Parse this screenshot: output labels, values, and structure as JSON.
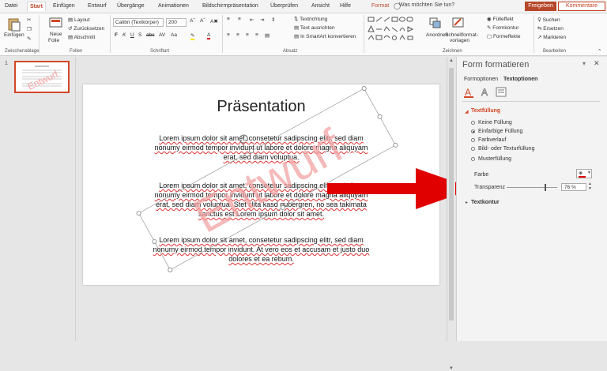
{
  "menu": {
    "tabs": [
      "Datei",
      "Start",
      "Einfügen",
      "Entwurf",
      "Übergänge",
      "Animationen",
      "Bildschirmpräsentation",
      "Überprüfen",
      "Ansicht",
      "Hilfe",
      "Format"
    ],
    "active_tab": "Start",
    "search_placeholder": "Was möchten Sie tun?",
    "share": "Freigeben",
    "comments": "Kommentare"
  },
  "ribbon": {
    "clipboard": {
      "paste": "Einfügen",
      "label": "Zwischenablage"
    },
    "slides": {
      "new": "Neue",
      "new2": "Folie",
      "layout": "Layout",
      "reset": "Zurücksetzen",
      "section": "Abschnitt",
      "label": "Folien"
    },
    "font": {
      "name": "Calibri (Textkörper)",
      "size": "200",
      "label": "Schriftart"
    },
    "paragraph": {
      "direction": "Textrichtung",
      "align": "Text ausrichten",
      "smartart": "In SmartArt konvertieren",
      "label": "Absatz"
    },
    "drawing": {
      "arrange": "Anordnen",
      "quickstyles": "Schnellformat-",
      "quickstyles2": "vorlagen",
      "fill": "Fülleffekt",
      "outline": "Formkontur",
      "effects": "Formeffekte",
      "label": "Zeichnen"
    },
    "editing": {
      "find": "Suchen",
      "replace": "Ersetzen",
      "select": "Markieren",
      "label": "Bearbeiten"
    }
  },
  "slide_panel": {
    "number": "1"
  },
  "slide": {
    "title": "Präsentation",
    "watermark": "Entwurf",
    "paragraphs": [
      [
        "Lorem ipsum dolor sit amet, consetetur sadipscing elitr, sed diam",
        "nonumy eirmod tempor invidunt ut labore et dolore magna aliquyam",
        "erat, sed diam voluptua."
      ],
      [
        "Lorem ipsum dolor sit amet, consetetur sadipscing elitr, sed diam",
        "nonumy eirmod tempor invidunt ut labore et dolore magna aliquyam",
        "erat, sed diam voluptua. Stet clita kasd gubergren, no sea takimata",
        "sanctus est Lorem ipsum dolor sit amet."
      ],
      [
        "Lorem ipsum dolor sit amet, consetetur sadipscing elitr, sed diam",
        "nonumy eirmod tempor invidunt. At vero eos et accusam et justo duo",
        "dolores et ea rebum."
      ]
    ]
  },
  "format_pane": {
    "title": "Form formatieren",
    "tabs": [
      "Formoptionen",
      "Textoptionen"
    ],
    "section_fill": "Textfüllung",
    "options": [
      "Keine Füllung",
      "Einfarbige Füllung",
      "Farbverlauf",
      "Bild- oder Texturfüllung",
      "Musterfüllung"
    ],
    "selected_option": "Einfarbige Füllung",
    "color_label": "Farbe",
    "transparency_label": "Transparenz",
    "transparency_value": "76 %",
    "section_outline": "Textkontur"
  },
  "colors": {
    "accent": "#b7472a",
    "arrow": "#e00000",
    "watermark": "#f2a3a3"
  }
}
